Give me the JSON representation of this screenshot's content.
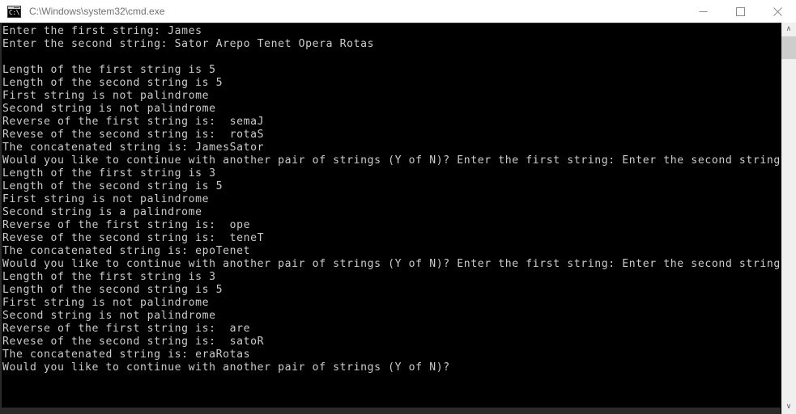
{
  "window": {
    "title": "C:\\Windows\\system32\\cmd.exe",
    "icon": "cmd-console-icon",
    "icon_glyph": "C:\\.",
    "controls": {
      "minimize": "minimize-icon",
      "maximize": "maximize-icon",
      "close": "close-icon"
    },
    "colors": {
      "titlebar_bg": "#ffffff",
      "titlebar_text": "#6f6f6f",
      "console_bg": "#000000",
      "console_text": "#cccccc",
      "frame": "#2b2b2b",
      "scrollbar_track": "#f0f0f0",
      "scrollbar_thumb": "#cdcdcd"
    }
  },
  "console": {
    "lines": [
      "Enter the first string: James",
      "Enter the second string: Sator Arepo Tenet Opera Rotas",
      "",
      "Length of the first string is 5",
      "Length of the second string is 5",
      "First string is not palindrome",
      "Second string is not palindrome",
      "Reverse of the first string is:  semaJ",
      "Revese of the second string is:  rotaS",
      "The concatenated string is: JamesSator",
      "Would you like to continue with another pair of strings (Y of N)? Enter the first string: Enter the second string:",
      "Length of the first string is 3",
      "Length of the second string is 5",
      "First string is not palindrome",
      "Second string is a palindrome",
      "Reverse of the first string is:  ope",
      "Revese of the second string is:  teneT",
      "The concatenated string is: epoTenet",
      "Would you like to continue with another pair of strings (Y of N)? Enter the first string: Enter the second string:",
      "Length of the first string is 3",
      "Length of the second string is 5",
      "First string is not palindrome",
      "Second string is not palindrome",
      "Reverse of the first string is:  are",
      "Revese of the second string is:  satoR",
      "The concatenated string is: eraRotas",
      "Would you like to continue with another pair of strings (Y of N)?"
    ]
  },
  "scrollbar": {
    "up_arrow": "∧",
    "down_arrow": "∨"
  }
}
